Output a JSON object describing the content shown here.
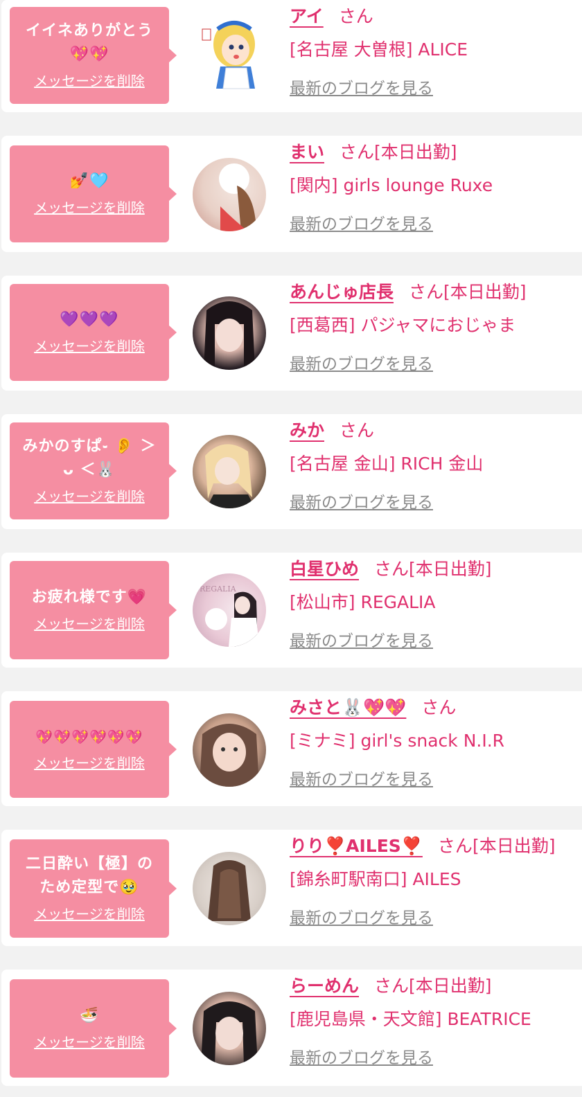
{
  "delete_label": "メッセージを削除",
  "blog_label": "最新のブログを見る",
  "san_label": "さん",
  "colors": {
    "accent": "#e0306e",
    "bubble": "#f58ea2",
    "link_gray": "#8a8a8a",
    "background": "#f2f2f2"
  },
  "items": [
    {
      "message": "イイネありがとう💖💖",
      "name": "アイ",
      "status": "",
      "shop": "[名古屋 大曽根] ALICE",
      "avatar": "alice-illustration"
    },
    {
      "message": "💅🩵",
      "name": "まい",
      "status": "[本日出勤]",
      "shop": "[関内] girls lounge Ruxe",
      "avatar": "photo"
    },
    {
      "message": "💜💜💜",
      "name": "あんじゅ店長",
      "status": "[本日出勤]",
      "shop": "[西葛西] パジャマにおじゃま",
      "avatar": "photo"
    },
    {
      "message": "みかのすぱ֊ 👂 ＞ ᴗ ＜🐰",
      "name": "みか",
      "status": "",
      "shop": "[名古屋 金山] RICH 金山",
      "avatar": "photo"
    },
    {
      "message": "お疲れ様です💗",
      "name": "白星ひめ",
      "status": "[本日出勤]",
      "shop": "[松山市] REGALIA",
      "avatar": "photo"
    },
    {
      "message": "💖💖💖💖💖💖",
      "name": "みさと🐰💖💖",
      "status": "",
      "shop": "[ミナミ] girl's snack N.I.R",
      "avatar": "photo"
    },
    {
      "message": "二日酔い【極】のため定型で🥹",
      "name": "りり❣️AILES❣️",
      "status": "[本日出勤]",
      "shop": "[錦糸町駅南口] AILES",
      "avatar": "photo"
    },
    {
      "message": "🍜",
      "name": "らーめん",
      "status": "[本日出勤]",
      "shop": "[鹿児島県・天文館] BEATRICE",
      "avatar": "photo"
    }
  ]
}
